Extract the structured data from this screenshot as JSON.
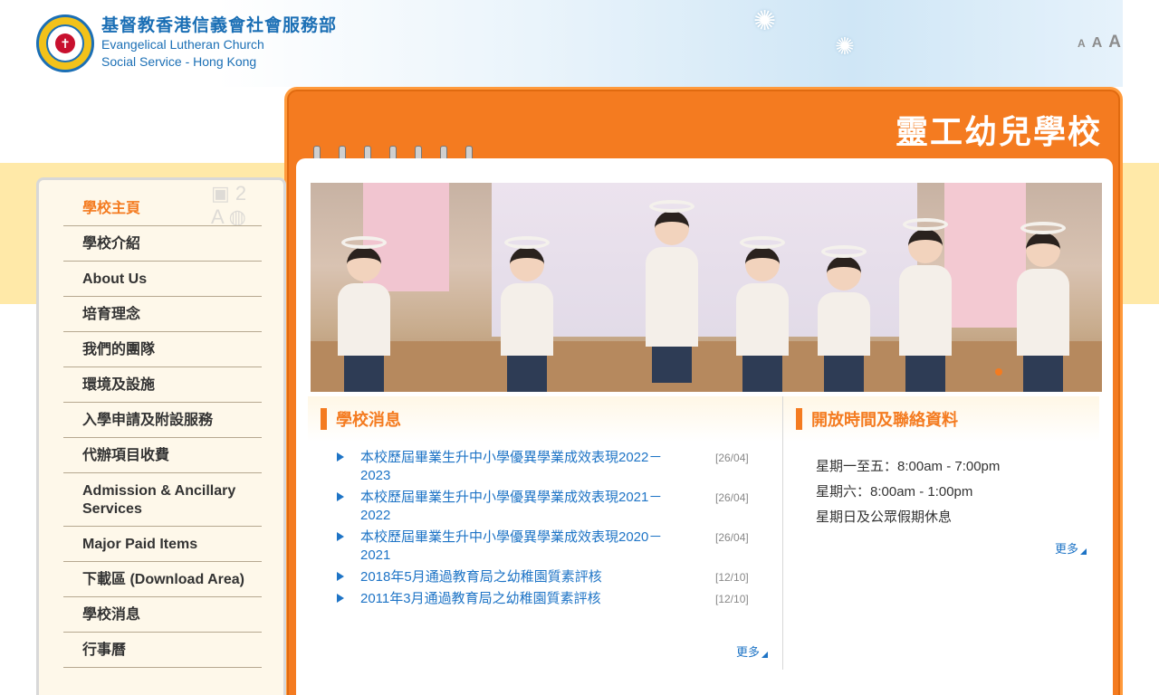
{
  "logo": {
    "zh": "基督教香港信義會社會服務部",
    "en_line1": "Evangelical Lutheran Church",
    "en_line2": "Social Service - Hong Kong"
  },
  "font_size_controls": [
    "A",
    "A",
    "A"
  ],
  "school_title": "靈工幼兒學校",
  "sidebar": {
    "items": [
      {
        "label": "學校主頁",
        "active": true
      },
      {
        "label": "學校介紹"
      },
      {
        "label": "About Us"
      },
      {
        "label": "培育理念"
      },
      {
        "label": "我們的團隊"
      },
      {
        "label": "環境及設施"
      },
      {
        "label": "入學申請及附設服務"
      },
      {
        "label": "代辦項目收費"
      },
      {
        "label": "Admission & Ancillary Services"
      },
      {
        "label": "Major Paid Items"
      },
      {
        "label": "下載區 (Download Area)"
      },
      {
        "label": "學校消息"
      },
      {
        "label": "行事曆"
      }
    ]
  },
  "news": {
    "title": "學校消息",
    "items": [
      {
        "title": "本校歷屆畢業生升中小學優異學業成效表現2022－2023",
        "date": "[26/04]"
      },
      {
        "title": "本校歷屆畢業生升中小學優異學業成效表現2021－2022",
        "date": "[26/04]"
      },
      {
        "title": "本校歷屆畢業生升中小學優異學業成效表現2020－2021",
        "date": "[26/04]"
      },
      {
        "title": "2018年5月通過教育局之幼稚園質素評核",
        "date": "[12/10]"
      },
      {
        "title": "2011年3月通過教育局之幼稚園質素評核",
        "date": "[12/10]"
      }
    ],
    "more": "更多"
  },
  "hours": {
    "title": "開放時間及聯絡資料",
    "lines": [
      "星期一至五：8:00am - 7:00pm",
      "星期六：8:00am - 1:00pm",
      "星期日及公眾假期休息"
    ],
    "more": "更多"
  },
  "colors": {
    "accent": "#f47b20",
    "link": "#1e74c6",
    "brand_blue": "#1b6fb5"
  }
}
